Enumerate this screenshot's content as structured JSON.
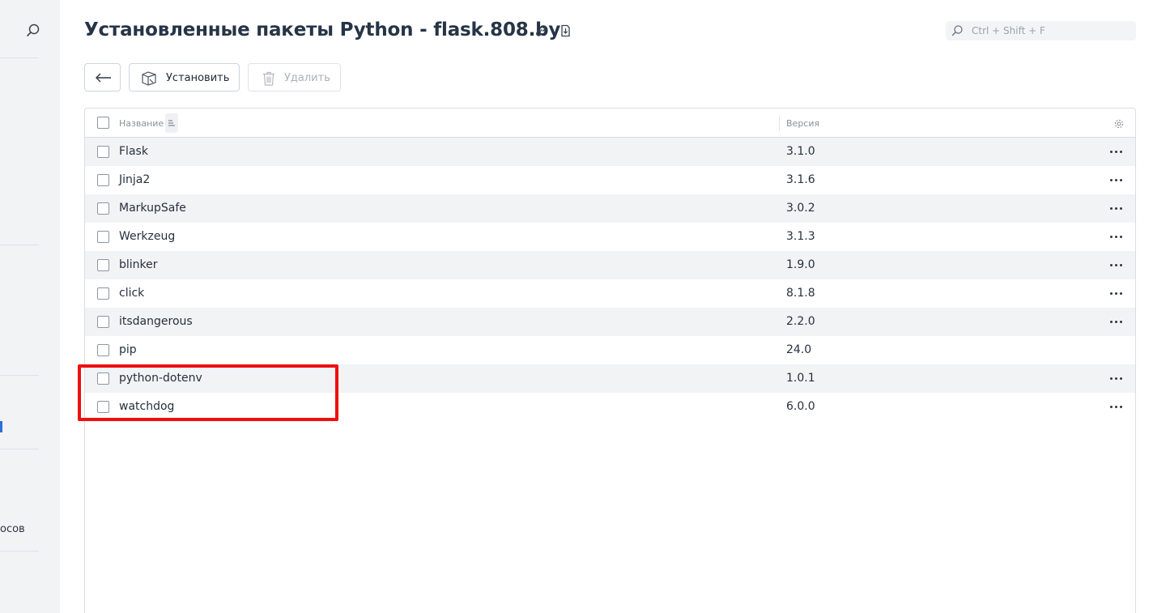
{
  "sidebar": {
    "search_icon": "search-icon",
    "partial_label": "осов"
  },
  "header": {
    "title": "Установленные пакеты Python - flask.808.by",
    "link_icon": "link-icon",
    "export_icon": "export-icon"
  },
  "search": {
    "placeholder": "Ctrl + Shift + F"
  },
  "toolbar": {
    "back_icon": "arrow-left-icon",
    "install_label": "Установить",
    "delete_label": "Удалить"
  },
  "table": {
    "columns": {
      "name": "Название",
      "version": "Версия"
    },
    "rows": [
      {
        "name": "Flask",
        "version": "3.1.0",
        "has_menu": true
      },
      {
        "name": "Jinja2",
        "version": "3.1.6",
        "has_menu": true
      },
      {
        "name": "MarkupSafe",
        "version": "3.0.2",
        "has_menu": true
      },
      {
        "name": "Werkzeug",
        "version": "3.1.3",
        "has_menu": true
      },
      {
        "name": "blinker",
        "version": "1.9.0",
        "has_menu": true
      },
      {
        "name": "click",
        "version": "8.1.8",
        "has_menu": true
      },
      {
        "name": "itsdangerous",
        "version": "2.2.0",
        "has_menu": true
      },
      {
        "name": "pip",
        "version": "24.0",
        "has_menu": false
      },
      {
        "name": "python-dotenv",
        "version": "1.0.1",
        "has_menu": true
      },
      {
        "name": "watchdog",
        "version": "6.0.0",
        "has_menu": true
      }
    ]
  },
  "colors": {
    "highlight": "#ee0f0f",
    "row_stripe": "#f2f3f5",
    "title": "#263447"
  }
}
